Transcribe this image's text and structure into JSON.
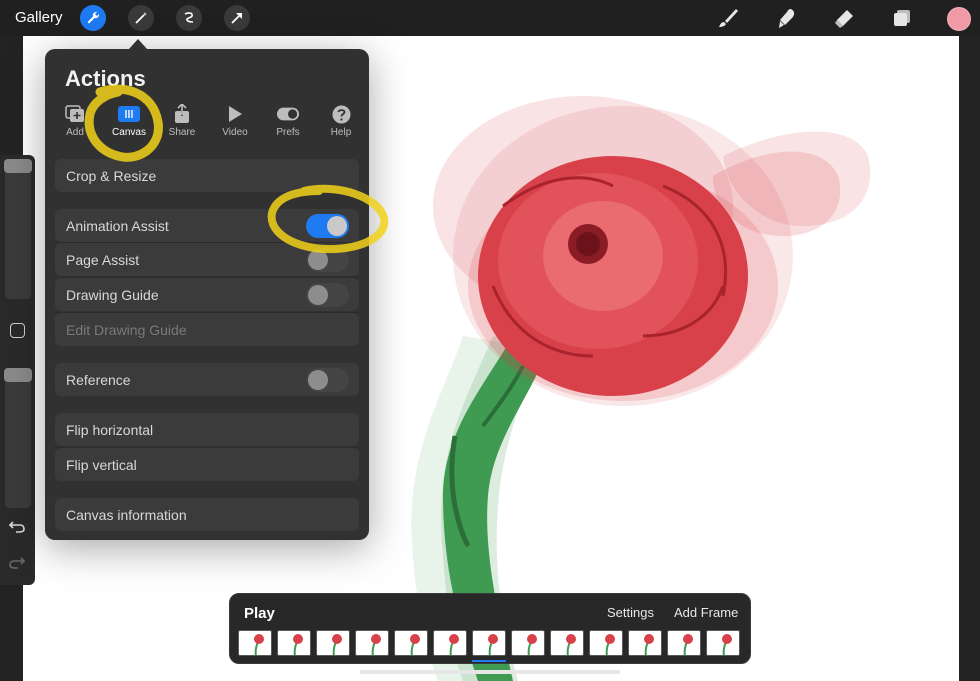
{
  "topbar": {
    "gallery_label": "Gallery",
    "tools_left": [
      "wrench-icon",
      "magic-wand-icon",
      "selection-icon",
      "transform-arrow-icon"
    ],
    "tools_right": [
      "brush-icon",
      "smudge-icon",
      "eraser-icon",
      "layers-icon"
    ],
    "current_color": "#ef9aa6"
  },
  "actions": {
    "title": "Actions",
    "tabs": [
      {
        "label": "Add",
        "icon": "add-image-icon"
      },
      {
        "label": "Canvas",
        "icon": "canvas-icon",
        "selected": true
      },
      {
        "label": "Share",
        "icon": "share-icon"
      },
      {
        "label": "Video",
        "icon": "play-icon"
      },
      {
        "label": "Prefs",
        "icon": "toggle-icon"
      },
      {
        "label": "Help",
        "icon": "help-icon"
      }
    ],
    "rows": {
      "crop": "Crop & Resize",
      "animation_assist": "Animation Assist",
      "page_assist": "Page Assist",
      "drawing_guide": "Drawing Guide",
      "edit_drawing_guide": "Edit Drawing Guide",
      "reference": "Reference",
      "flip_horizontal": "Flip horizontal",
      "flip_vertical": "Flip vertical",
      "canvas_info": "Canvas information"
    },
    "toggles": {
      "animation_assist": true,
      "page_assist": false,
      "drawing_guide": false,
      "reference": false
    }
  },
  "animation_bar": {
    "play_label": "Play",
    "settings_label": "Settings",
    "add_frame_label": "Add Frame",
    "frame_count": 13,
    "selected_frame": 7
  },
  "colors": {
    "accent": "#1e7bf2",
    "highlight": "#f2d21a",
    "flower": "#d8414a",
    "stem": "#3f9a52"
  }
}
